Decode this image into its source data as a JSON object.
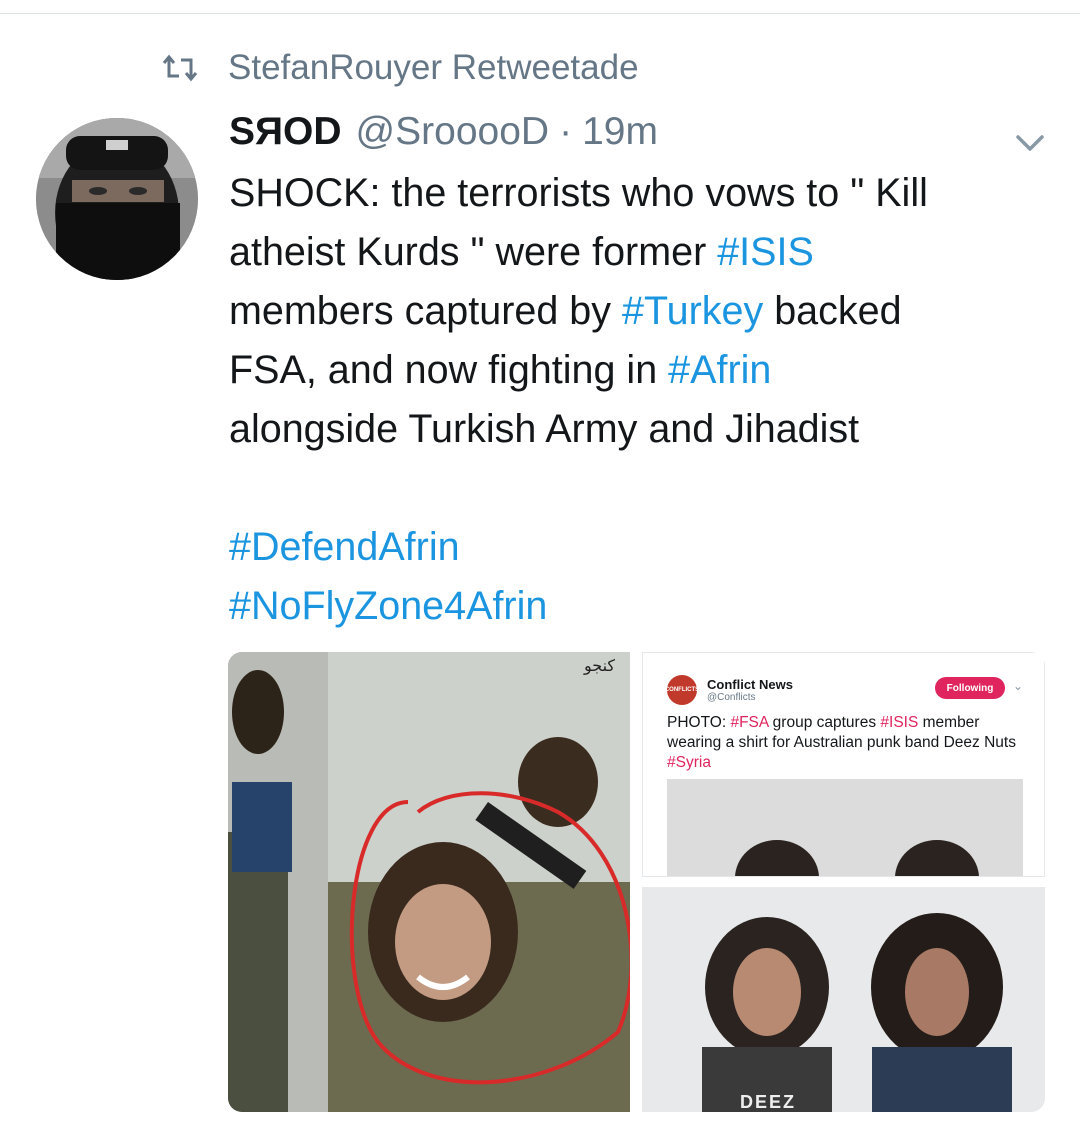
{
  "retweet": {
    "icon": "retweet-icon",
    "text": "StefanRouyer Retweetade"
  },
  "tweet": {
    "display_name": "SЯOD",
    "handle": "@SrooooD",
    "separator": "·",
    "time": "19m",
    "caret_icon": "chevron-down-icon",
    "text_segments": {
      "l1": "SHOCK: the terrorists who vows to \" Kill",
      "l2a": "atheist Kurds \" were former ",
      "l2b": "#ISIS",
      "l3a": "members captured by ",
      "l3b": "#Turkey",
      "l3c": " backed",
      "l4a": "FSA, and now fighting in ",
      "l4b": "#Afrin",
      "l5": "alongside Turkish Army and Jihadist",
      "h1": "#DefendAfrin",
      "h2": "#NoFlyZone4Afrin"
    }
  },
  "media": {
    "left_watermark": "کنجو",
    "embedded_tweet": {
      "logo_text": "CONFLICTS",
      "name": "Conflict News",
      "handle": "@Conflicts",
      "follow_label": "Following",
      "text_a": "PHOTO: ",
      "tag_fsa": "#FSA",
      "text_b": " group captures ",
      "tag_isis": "#ISIS",
      "text_c": " member wearing a shirt for Australian punk band Deez Nuts ",
      "tag_syria": "#Syria"
    },
    "shirt_text": "DEEZ"
  },
  "colors": {
    "link": "#1b95e0",
    "muted": "#657786",
    "follow": "#e0245e"
  }
}
